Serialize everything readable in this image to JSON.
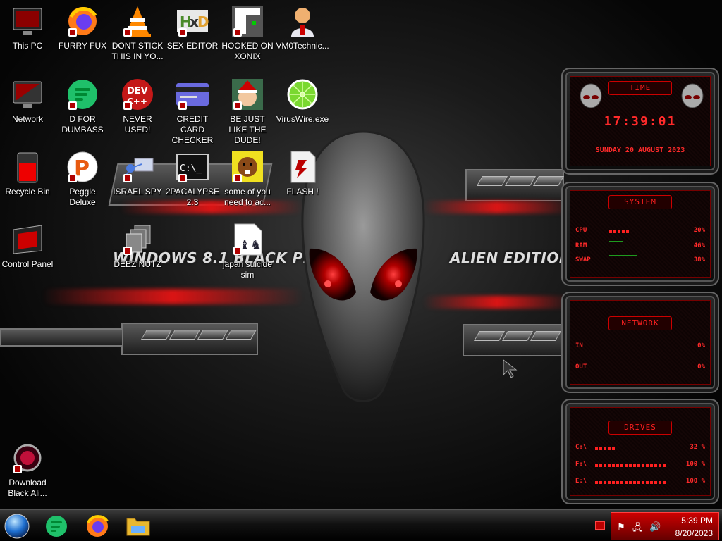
{
  "wallpaper": {
    "left_text": "WINDOWS 8.1 BLACK PRO",
    "right_text": "ALIEN EDITION 20"
  },
  "desktop": {
    "icons": [
      {
        "label": "This PC",
        "icon": "monitor-icon"
      },
      {
        "label": "FURRY FUX",
        "icon": "firefox-icon"
      },
      {
        "label": "DONT STICK THIS IN YO...",
        "icon": "vlc-cone-icon"
      },
      {
        "label": "SEX EDITOR",
        "icon": "hxd-editor-icon"
      },
      {
        "label": "HOOKED ON XONIX",
        "icon": "xonix-game-icon"
      },
      {
        "label": "VM0Technic...",
        "icon": "technician-icon"
      },
      {
        "label": "Network",
        "icon": "network-icon"
      },
      {
        "label": "D FOR DUMBASS",
        "icon": "green-doc-icon"
      },
      {
        "label": "NEVER USED!",
        "icon": "devcpp-icon"
      },
      {
        "label": "CREDIT CARD CHECKER",
        "icon": "credit-card-icon"
      },
      {
        "label": "BE JUST LIKE THE DUDE!",
        "icon": "santa-elf-icon"
      },
      {
        "label": "VirusWire.exe",
        "icon": "lime-icon"
      },
      {
        "label": "Recycle Bin",
        "icon": "recycle-bin-icon"
      },
      {
        "label": "Peggle Deluxe",
        "icon": "peggle-icon"
      },
      {
        "label": "ISRAEL SPY",
        "icon": "spy-network-icon"
      },
      {
        "label": "2PACALYPSE 2.3",
        "icon": "terminal-icon"
      },
      {
        "label": "some of you need to ac...",
        "icon": "beaver-icon"
      },
      {
        "label": "FLASH !",
        "icon": "flash-file-icon"
      },
      {
        "label": "Control Panel",
        "icon": "control-panel-icon"
      },
      {
        "label": "DEEZ NUTZ",
        "icon": "stack-files-icon"
      },
      {
        "label": "japan suicide sim",
        "icon": "chess-file-icon"
      },
      {
        "label": "Download Black Ali...",
        "icon": "alien-download-icon"
      }
    ]
  },
  "gadgets": {
    "time": {
      "title": "TIME",
      "clock": "17:39:01",
      "date": "SUNDAY 20 AUGUST 2023"
    },
    "system": {
      "title": "SYSTEM",
      "rows": [
        {
          "name": "CPU",
          "value": "20%",
          "level": 0.2
        },
        {
          "name": "RAM",
          "value": "46%",
          "level": 0.46
        },
        {
          "name": "SWAP",
          "value": "38%",
          "level": 0.38
        }
      ]
    },
    "network": {
      "title": "NETWORK",
      "rows": [
        {
          "name": "IN",
          "value": "0%"
        },
        {
          "name": "OUT",
          "value": "0%"
        }
      ]
    },
    "drives": {
      "title": "DRIVES",
      "rows": [
        {
          "name": "C:\\",
          "value": "32 %",
          "level": 0.32
        },
        {
          "name": "F:\\",
          "value": "100 %",
          "level": 1.0
        },
        {
          "name": "E:\\",
          "value": "100 %",
          "level": 1.0
        }
      ]
    }
  },
  "taskbar": {
    "apps": [
      {
        "name": "start-orb",
        "icon": "start-orb-icon"
      },
      {
        "name": "green-doc",
        "icon": "green-doc-icon"
      },
      {
        "name": "firefox",
        "icon": "firefox-icon"
      },
      {
        "name": "file-explorer",
        "icon": "folder-icon"
      }
    ],
    "time": "5:39 PM",
    "date": "8/20/2023",
    "colors": {
      "accent": "#cc0000",
      "glow": "#ff2020"
    }
  }
}
